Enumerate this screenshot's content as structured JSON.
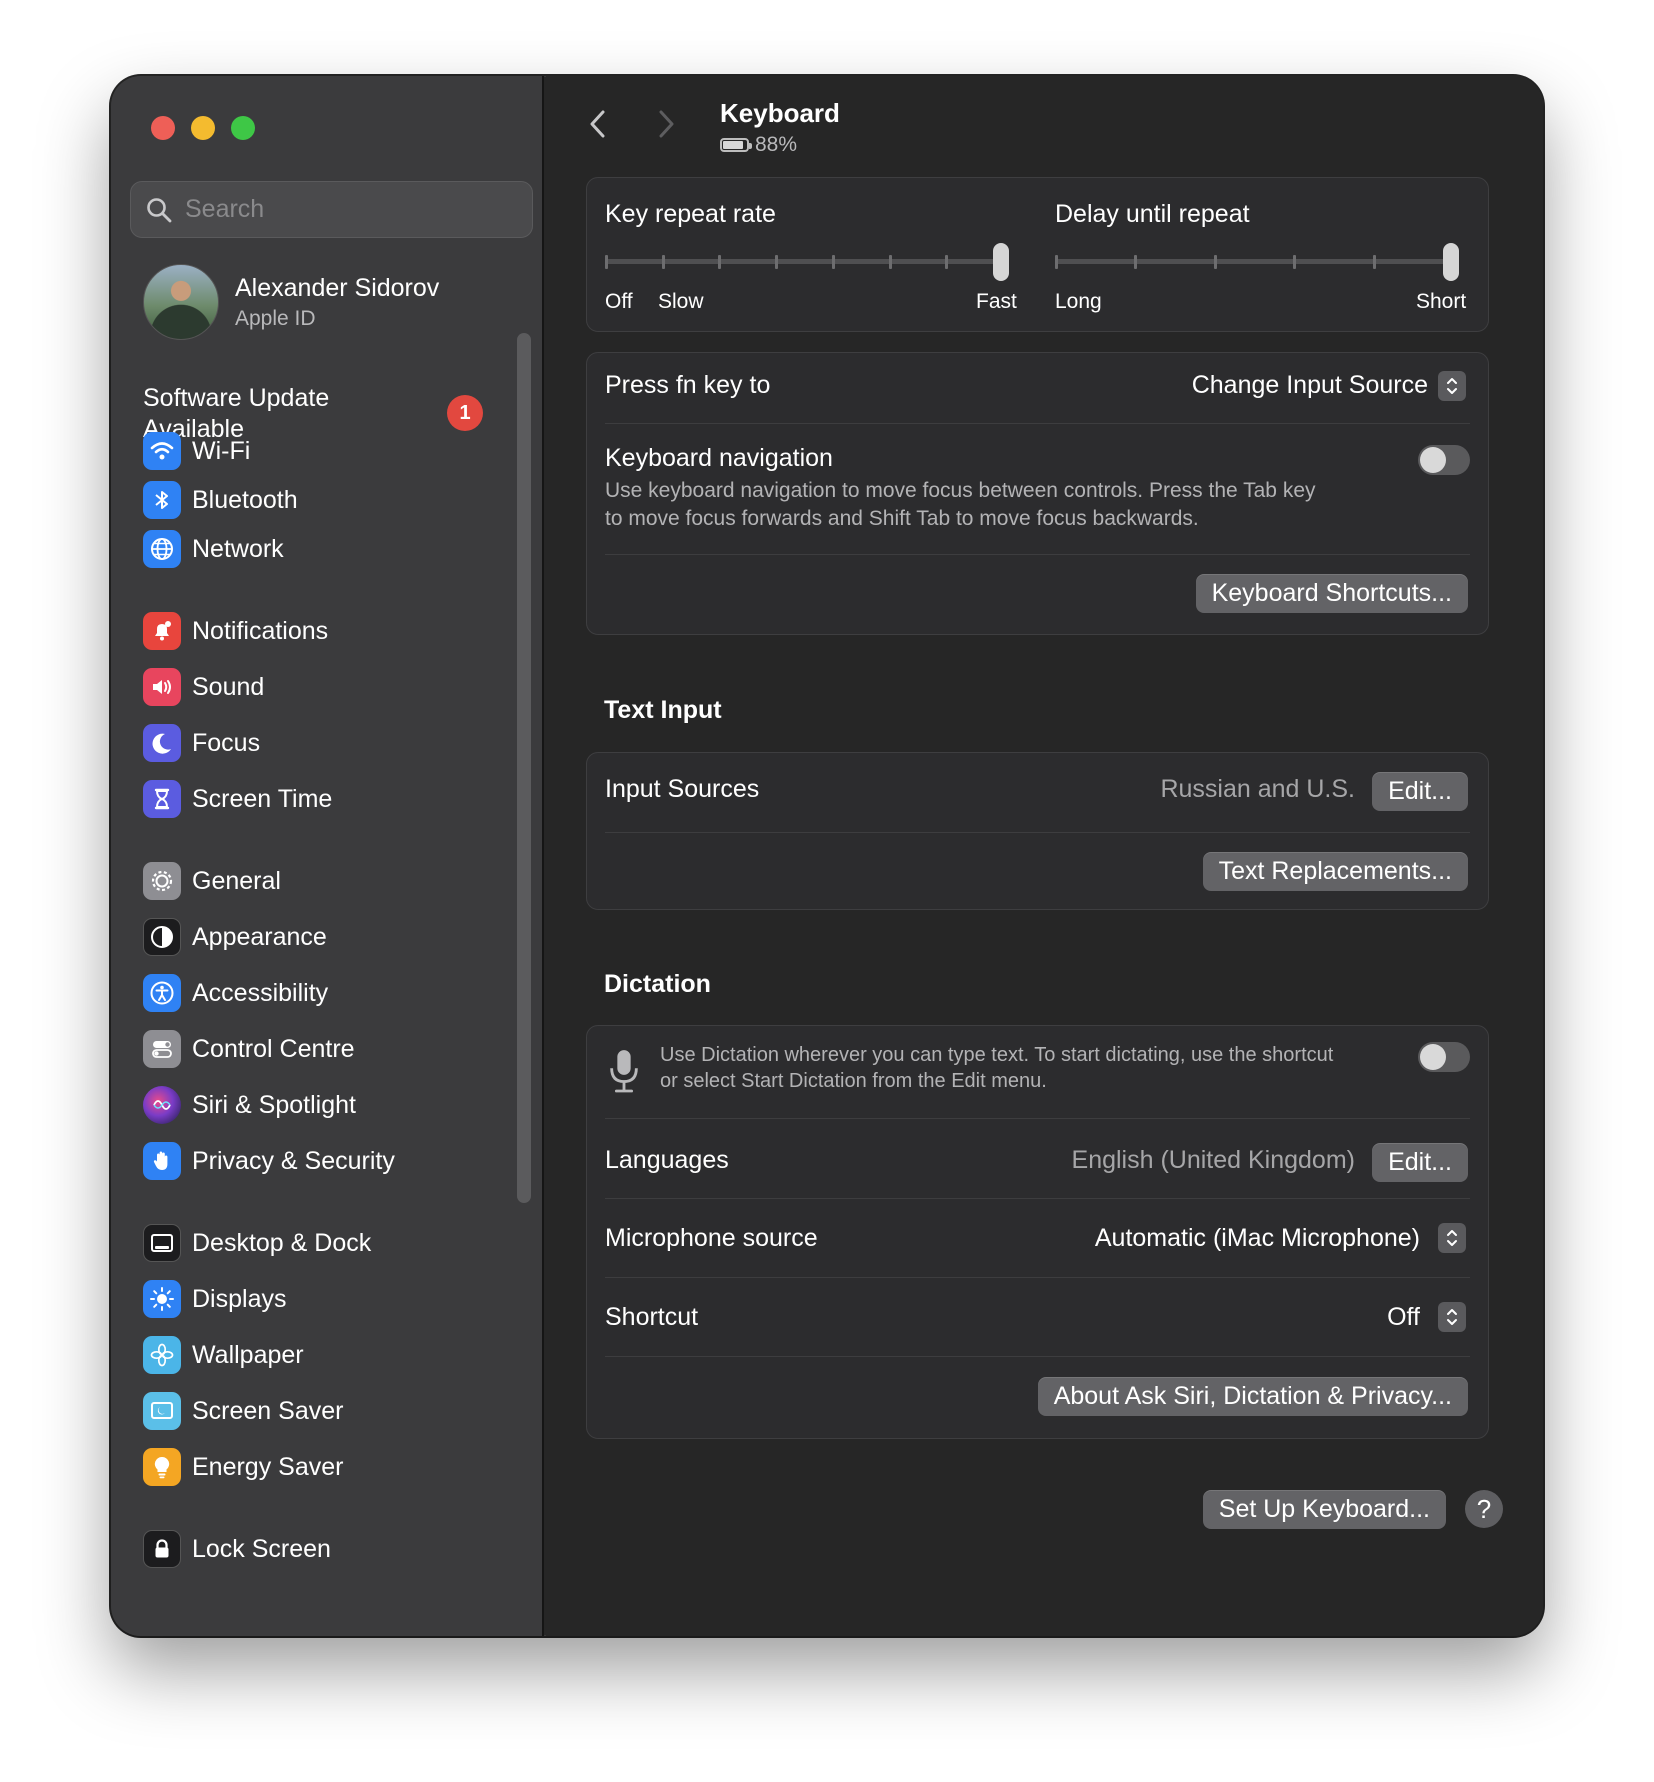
{
  "sidebar": {
    "search_placeholder": "Search",
    "profile": {
      "name": "Alexander Sidorov",
      "subtitle": "Apple ID"
    },
    "software_update": {
      "label": "Software Update Available",
      "badge": "1"
    },
    "items": [
      {
        "label": "Wi-Fi",
        "icon": "wifi-icon",
        "color": "#2f82f4"
      },
      {
        "label": "Bluetooth",
        "icon": "bluetooth-icon",
        "color": "#2f82f4"
      },
      {
        "label": "Network",
        "icon": "globe-icon",
        "color": "#2f82f4"
      },
      {
        "label": "Notifications",
        "icon": "bell-icon",
        "color": "#e8453d"
      },
      {
        "label": "Sound",
        "icon": "speaker-icon",
        "color": "#e8455e"
      },
      {
        "label": "Focus",
        "icon": "moon-icon",
        "color": "#5b5ce0"
      },
      {
        "label": "Screen Time",
        "icon": "hourglass-icon",
        "color": "#5b5ce0"
      },
      {
        "label": "General",
        "icon": "gear-icon",
        "color": "#8e8e93"
      },
      {
        "label": "Appearance",
        "icon": "appearance-icon",
        "color": "#1c1c1e"
      },
      {
        "label": "Accessibility",
        "icon": "accessibility-icon",
        "color": "#2f82f4"
      },
      {
        "label": "Control Centre",
        "icon": "control-centre-icon",
        "color": "#8e8e93"
      },
      {
        "label": "Siri & Spotlight",
        "icon": "siri-icon",
        "color": "#7a3cc7"
      },
      {
        "label": "Privacy & Security",
        "icon": "hand-icon",
        "color": "#2f82f4"
      },
      {
        "label": "Desktop & Dock",
        "icon": "dock-icon",
        "color": "#1c1c1e"
      },
      {
        "label": "Displays",
        "icon": "sun-icon",
        "color": "#2f82f4"
      },
      {
        "label": "Wallpaper",
        "icon": "flower-icon",
        "color": "#4bb5e8"
      },
      {
        "label": "Screen Saver",
        "icon": "screen-saver-icon",
        "color": "#5bbfe8"
      },
      {
        "label": "Energy Saver",
        "icon": "lightbulb-icon",
        "color": "#f4a623"
      },
      {
        "label": "Lock Screen",
        "icon": "lock-icon",
        "color": "#1c1c1e"
      }
    ]
  },
  "header": {
    "title": "Keyboard",
    "battery_percent": "88%",
    "battery_level": 0.88
  },
  "repeat": {
    "key_repeat_label": "Key repeat rate",
    "key_repeat_off": "Off",
    "key_repeat_slow": "Slow",
    "key_repeat_fast": "Fast",
    "key_repeat_level": 1.0,
    "delay_label": "Delay until repeat",
    "delay_long": "Long",
    "delay_short": "Short",
    "delay_level": 1.0
  },
  "fn": {
    "label": "Press fn key to",
    "value": "Change Input Source",
    "nav_label": "Keyboard navigation",
    "nav_desc_1": "Use keyboard navigation to move focus between controls. Press the Tab key",
    "nav_desc_2": "to move focus forwards and Shift Tab to move focus backwards.",
    "nav_enabled": false,
    "shortcuts_button": "Keyboard Shortcuts..."
  },
  "text_input": {
    "section_title": "Text Input",
    "sources_label": "Input Sources",
    "sources_value": "Russian and U.S.",
    "edit_button": "Edit...",
    "replacements_button": "Text Replacements..."
  },
  "dictation": {
    "section_title": "Dictation",
    "desc_1": "Use Dictation wherever you can type text. To start dictating, use the shortcut",
    "desc_2": "or select Start Dictation from the Edit menu.",
    "enabled": false,
    "languages_label": "Languages",
    "languages_value": "English (United Kingdom)",
    "edit_button": "Edit...",
    "mic_label": "Microphone source",
    "mic_value": "Automatic (iMac Microphone)",
    "shortcut_label": "Shortcut",
    "shortcut_value": "Off",
    "about_button": "About Ask Siri, Dictation & Privacy..."
  },
  "footer": {
    "setup_button": "Set Up Keyboard...",
    "help_button": "?"
  }
}
